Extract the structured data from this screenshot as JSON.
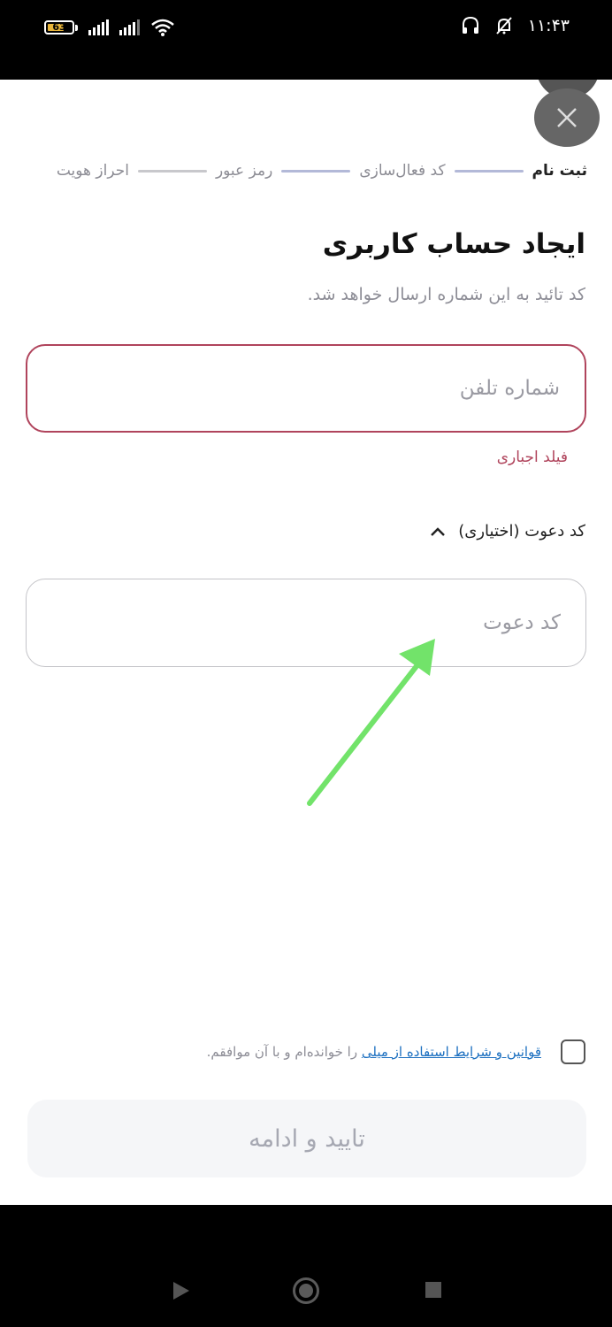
{
  "status_bar": {
    "battery_level": "63",
    "time": "۱۱:۴۳"
  },
  "stepper": {
    "steps": [
      "ثبت نام",
      "کد فعال‌سازی",
      "رمز عبور",
      "احراز هویت"
    ]
  },
  "form": {
    "title": "ایجاد حساب کاربری",
    "subtitle": "کد تائید به این شماره ارسال خواهد شد.",
    "phone_placeholder": "شماره تلفن",
    "phone_error": "فیلد اجباری",
    "invite_toggle_label": "کد دعوت (اختیاری)",
    "invite_placeholder": "کد دعوت"
  },
  "terms": {
    "link_text": "قوانین و شرایط استفاده از میلی",
    "rest_text": "را خوانده‌ام و با آن موافقم."
  },
  "submit_label": "تایید و ادامه",
  "colors": {
    "error": "#b0445c",
    "link": "#1b6fc0",
    "step_line": "#b3b9d8",
    "annotation_arrow": "#72e36a"
  }
}
